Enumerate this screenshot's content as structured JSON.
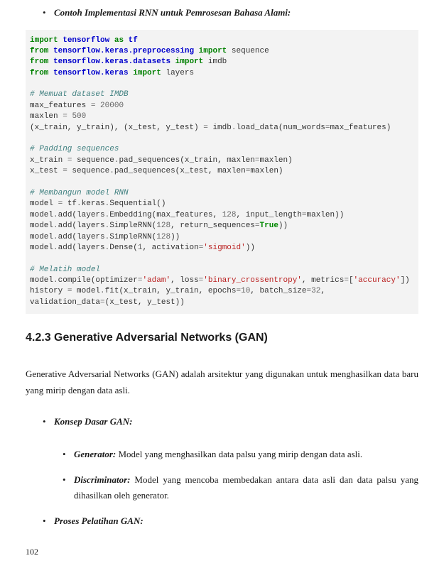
{
  "heading1": "Contoh Implementasi RNN untuk Pemrosesan Bahasa Alami:",
  "code": {
    "l1a": "import",
    "l1b": "tensorflow",
    "l1c": "as",
    "l1d": "tf",
    "l2a": "from",
    "l2b": "tensorflow.keras.preprocessing",
    "l2c": "import",
    "l2d": "sequence",
    "l3a": "from",
    "l3b": "tensorflow.keras.datasets",
    "l3c": "import",
    "l3d": "imdb",
    "l4a": "from",
    "l4b": "tensorflow.keras",
    "l4c": "import",
    "l4d": "layers",
    "c1": "# Memuat dataset IMDB",
    "l5a": "max_features ",
    "l5b": "=",
    "l5c": " ",
    "l5d": "20000",
    "l6a": "maxlen ",
    "l6b": "=",
    "l6c": " ",
    "l6d": "500",
    "l7a": "(x_train, y_train), (x_test, y_test) ",
    "l7b": "=",
    "l7c": " imdb",
    "l7d": ".",
    "l7e": "load_data(num_words",
    "l7f": "=",
    "l7g": "max_features)",
    "c2": "# Padding sequences",
    "l8a": "x_train ",
    "l8b": "=",
    "l8c": " sequence",
    "l8d": ".",
    "l8e": "pad_sequences(x_train, maxlen",
    "l8f": "=",
    "l8g": "maxlen)",
    "l9a": "x_test ",
    "l9b": "=",
    "l9c": " sequence",
    "l9d": ".",
    "l9e": "pad_sequences(x_test, maxlen",
    "l9f": "=",
    "l9g": "maxlen)",
    "c3": "# Membangun model RNN",
    "l10a": "model ",
    "l10b": "=",
    "l10c": " tf",
    "l10d": ".",
    "l10e": "keras",
    "l10f": ".",
    "l10g": "Sequential()",
    "l11a": "model",
    "l11b": ".",
    "l11c": "add(layers",
    "l11d": ".",
    "l11e": "Embedding(max_features, ",
    "l11f": "128",
    "l11g": ", input_length",
    "l11h": "=",
    "l11i": "maxlen))",
    "l12a": "model",
    "l12b": ".",
    "l12c": "add(layers",
    "l12d": ".",
    "l12e": "SimpleRNN(",
    "l12f": "128",
    "l12g": ", return_sequences",
    "l12h": "=",
    "l12i": "True",
    "l12j": "))",
    "l13a": "model",
    "l13b": ".",
    "l13c": "add(layers",
    "l13d": ".",
    "l13e": "SimpleRNN(",
    "l13f": "128",
    "l13g": "))",
    "l14a": "model",
    "l14b": ".",
    "l14c": "add(layers",
    "l14d": ".",
    "l14e": "Dense(",
    "l14f": "1",
    "l14g": ", activation",
    "l14h": "=",
    "l14i": "'sigmoid'",
    "l14j": "))",
    "c4": "# Melatih model",
    "l15a": "model",
    "l15b": ".",
    "l15c": "compile(optimizer",
    "l15d": "=",
    "l15e": "'adam'",
    "l15f": ", loss",
    "l15g": "=",
    "l15h": "'binary_crossentropy'",
    "l15i": ", metrics",
    "l15j": "=",
    "l15k": "[",
    "l15l": "'accuracy'",
    "l15m": "])",
    "l16a": "history ",
    "l16b": "=",
    "l16c": " model",
    "l16d": ".",
    "l16e": "fit(x_train, y_train, epochs",
    "l16f": "=",
    "l16g": "10",
    "l16h": ", batch_size",
    "l16i": "=",
    "l16j": "32",
    "l16k": ",",
    "l17a": "validation_data",
    "l17b": "=",
    "l17c": "(x_test, y_test))"
  },
  "section": "4.2.3 Generative Adversarial Networks (GAN)",
  "para1": "Generative Adversarial Networks (GAN) adalah arsitektur yang digunakan untuk meng­hasilkan data baru yang mirip dengan data asli.",
  "bullet_konsep": "Konsep Dasar GAN:",
  "gen_label": "Generator:",
  "gen_text": " Model yang menghasilkan data palsu yang mirip dengan data asli.",
  "disc_label": "Discriminator:",
  "disc_text": " Model yang mencoba membedakan antara data asli dan da­ta palsu yang dihasilkan oleh generator.",
  "bullet_proses": "Proses Pelatihan GAN:",
  "page_num": "102"
}
